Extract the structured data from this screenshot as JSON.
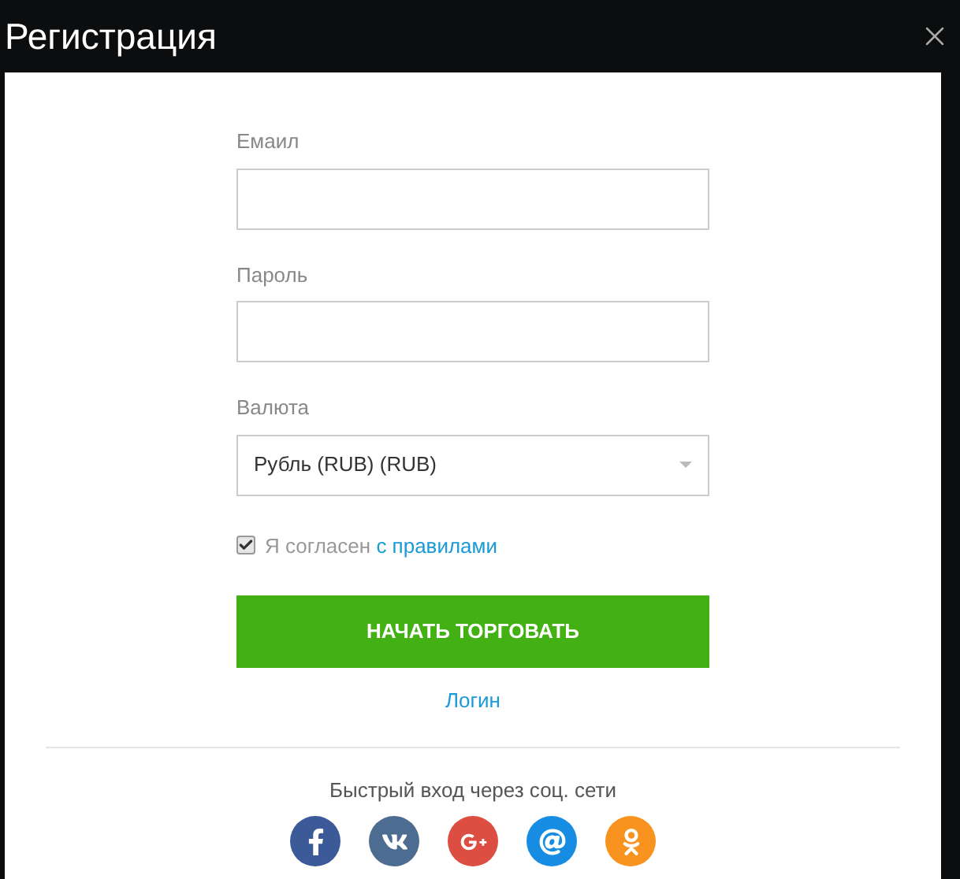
{
  "dialog": {
    "title": "Регистрация"
  },
  "form": {
    "fields": [
      {
        "kind": "input",
        "label": "Емаил"
      },
      {
        "kind": "input",
        "label": "Пароль"
      },
      {
        "kind": "select",
        "label": "Валюта",
        "value": "Рубль (RUB) (RUB)"
      }
    ],
    "agree": {
      "checked": true,
      "text": "Я согласен",
      "link": "с правилами"
    },
    "submit": "НАЧАТЬ ТОРГОВАТЬ",
    "login_link": "Логин"
  },
  "social": {
    "heading": "Быстрый вход через соц. сети",
    "networks": [
      {
        "kind": "facebook",
        "color": "#3d5a98"
      },
      {
        "kind": "vk",
        "color": "#4c6c91"
      },
      {
        "kind": "googleplus",
        "color": "#dc4e41"
      },
      {
        "kind": "mail",
        "color": "#168de2"
      },
      {
        "kind": "odnoklassniki",
        "color": "#f7931e"
      }
    ]
  }
}
